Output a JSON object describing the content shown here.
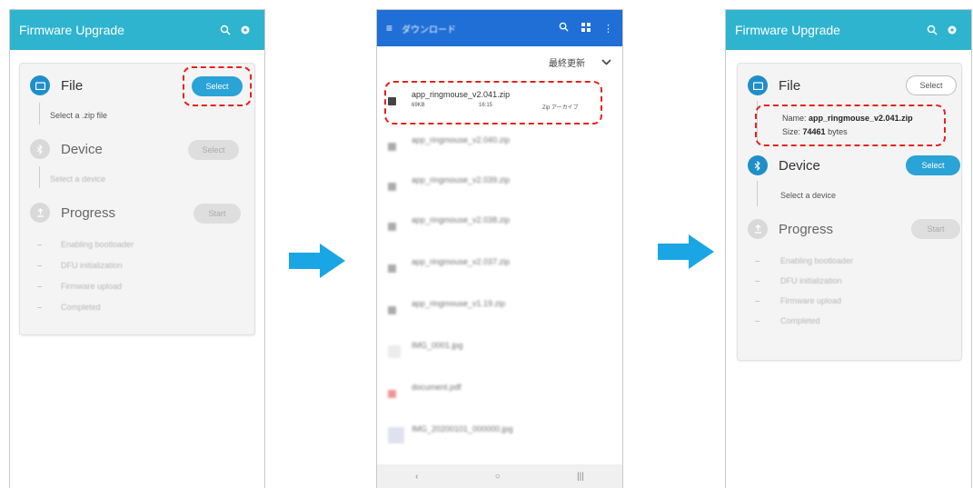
{
  "colors": {
    "appbar": "#2fb4cf",
    "accent": "#2aa3d6",
    "highlight": "#e8211c",
    "arrow": "#1aa6e4",
    "download_bar": "#1f6fd6"
  },
  "screen1": {
    "title": "Firmware Upgrade",
    "file_label": "File",
    "file_button": "Select",
    "file_hint": "Select a .zip file",
    "device_label": "Device",
    "device_button": "Select",
    "device_hint": "Select a device",
    "progress_label": "Progress",
    "progress_button": "Start",
    "steps": [
      "Enabling bootloader",
      "DFU initialization",
      "Firmware upload",
      "Completed"
    ]
  },
  "screen2": {
    "title": "ダウンロード",
    "sort_label": "最終更新",
    "files": [
      {
        "name": "app_ringmouse_v2.041.zip",
        "size": "69KB",
        "time": "16:15",
        "type": "Zip アーカイブ"
      },
      {
        "name": "app_ringmouse_v2.040.zip",
        "size": "",
        "time": "",
        "type": ""
      },
      {
        "name": "app_ringmouse_v2.039.zip",
        "size": "",
        "time": "",
        "type": ""
      },
      {
        "name": "app_ringmouse_v2.038.zip",
        "size": "",
        "time": "",
        "type": ""
      },
      {
        "name": "app_ringmouse_v2.037.zip",
        "size": "",
        "time": "",
        "type": ""
      },
      {
        "name": "app_ringmouse_v1.19.zip",
        "size": "",
        "time": "",
        "type": ""
      },
      {
        "name": "IMG_0001.jpg",
        "size": "",
        "time": "",
        "type": ""
      },
      {
        "name": "document.pdf",
        "size": "",
        "time": "",
        "type": ""
      },
      {
        "name": "IMG_20200101_000000.jpg",
        "size": "",
        "time": "",
        "type": ""
      }
    ],
    "nav": [
      "‹",
      "○",
      "|||"
    ]
  },
  "screen3": {
    "title": "Firmware Upgrade",
    "file_label": "File",
    "file_button": "Select",
    "name_label": "Name:",
    "name_value": "app_ringmouse_v2.041.zip",
    "size_label": "Size:",
    "size_value": "74461",
    "size_unit": "bytes",
    "device_label": "Device",
    "device_button": "Select",
    "device_hint": "Select a device",
    "progress_label": "Progress",
    "progress_button": "Start",
    "steps": [
      "Enabling bootloader",
      "DFU initialization",
      "Firmware upload",
      "Completed"
    ]
  }
}
